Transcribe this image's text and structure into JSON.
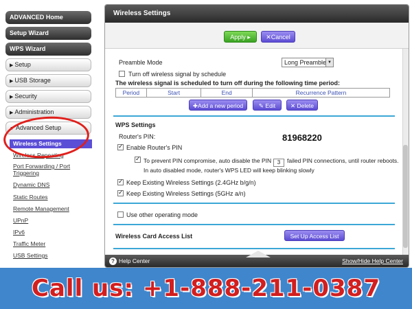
{
  "nav": {
    "top_buttons": [
      "ADVANCED Home",
      "Setup Wizard",
      "WPS Wizard"
    ],
    "sections": [
      "Setup",
      "USB Storage",
      "Security",
      "Administration",
      "Advanced Setup"
    ],
    "advanced_items": [
      "Wireless Settings",
      "Wireless Repeating",
      "Port Forwarding / Port Triggering",
      "Dynamic DNS",
      "Static Routes",
      "Remote Management",
      "UPnP",
      "IPv6",
      "Traffic Meter",
      "USB Settings"
    ],
    "active_item": "Wireless Settings"
  },
  "panel": {
    "title": "Wireless Settings",
    "apply_label": "Apply",
    "cancel_label": "Cancel",
    "preamble_label": "Preamble Mode",
    "preamble_value": "Long Preamble",
    "schedule_checkbox_label": "Turn off wireless signal by schedule",
    "schedule_heading": "The wireless signal is scheduled to turn off during the following time period:",
    "schedule_columns": [
      "Period",
      "Start",
      "End",
      "Recurrence Pattern"
    ],
    "add_period_label": "Add a new period",
    "edit_label": "Edit",
    "delete_label": "Delete",
    "wps_heading": "WPS Settings",
    "router_pin_label": "Router's PIN:",
    "router_pin_value": "81968220",
    "enable_pin_label": "Enable Router's PIN",
    "pin_protect_prefix": "To prevent PIN compromise, auto disable the PIN after",
    "pin_attempts_value": "3",
    "pin_protect_suffix": "failed PIN connections, until router reboots.",
    "pin_note": "In auto disabled mode, router's WPS LED will keep blinking slowly",
    "keep_24_label": "Keep Existing Wireless Settings (2.4GHz b/g/n)",
    "keep_5_label": "Keep Existing Wireless Settings (5GHz a/n)",
    "other_mode_label": "Use other operating mode",
    "access_list_heading": "Wireless Card Access List",
    "access_list_button": "Set Up Access List"
  },
  "footer": {
    "help_label": "Help Center",
    "showhide_label": "Show/Hide Help Center"
  },
  "banner": {
    "text": "Call us: +1-888-211-0387"
  },
  "colors": {
    "accent_purple": "#5d4dd4",
    "apply_green": "#3aa322",
    "divider_blue": "#3ba7d6",
    "banner_blue": "#3f86cc",
    "call_red": "#d21f1f",
    "highlight_ring": "#e0201c"
  }
}
